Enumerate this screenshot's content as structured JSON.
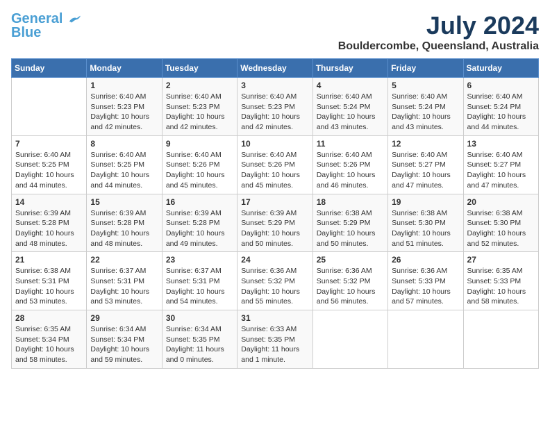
{
  "header": {
    "logo_line1": "General",
    "logo_line2": "Blue",
    "month_title": "July 2024",
    "location": "Bouldercombe, Queensland, Australia"
  },
  "days_of_week": [
    "Sunday",
    "Monday",
    "Tuesday",
    "Wednesday",
    "Thursday",
    "Friday",
    "Saturday"
  ],
  "weeks": [
    [
      {
        "num": "",
        "info": ""
      },
      {
        "num": "1",
        "info": "Sunrise: 6:40 AM\nSunset: 5:23 PM\nDaylight: 10 hours\nand 42 minutes."
      },
      {
        "num": "2",
        "info": "Sunrise: 6:40 AM\nSunset: 5:23 PM\nDaylight: 10 hours\nand 42 minutes."
      },
      {
        "num": "3",
        "info": "Sunrise: 6:40 AM\nSunset: 5:23 PM\nDaylight: 10 hours\nand 42 minutes."
      },
      {
        "num": "4",
        "info": "Sunrise: 6:40 AM\nSunset: 5:24 PM\nDaylight: 10 hours\nand 43 minutes."
      },
      {
        "num": "5",
        "info": "Sunrise: 6:40 AM\nSunset: 5:24 PM\nDaylight: 10 hours\nand 43 minutes."
      },
      {
        "num": "6",
        "info": "Sunrise: 6:40 AM\nSunset: 5:24 PM\nDaylight: 10 hours\nand 44 minutes."
      }
    ],
    [
      {
        "num": "7",
        "info": "Sunrise: 6:40 AM\nSunset: 5:25 PM\nDaylight: 10 hours\nand 44 minutes."
      },
      {
        "num": "8",
        "info": "Sunrise: 6:40 AM\nSunset: 5:25 PM\nDaylight: 10 hours\nand 44 minutes."
      },
      {
        "num": "9",
        "info": "Sunrise: 6:40 AM\nSunset: 5:26 PM\nDaylight: 10 hours\nand 45 minutes."
      },
      {
        "num": "10",
        "info": "Sunrise: 6:40 AM\nSunset: 5:26 PM\nDaylight: 10 hours\nand 45 minutes."
      },
      {
        "num": "11",
        "info": "Sunrise: 6:40 AM\nSunset: 5:26 PM\nDaylight: 10 hours\nand 46 minutes."
      },
      {
        "num": "12",
        "info": "Sunrise: 6:40 AM\nSunset: 5:27 PM\nDaylight: 10 hours\nand 47 minutes."
      },
      {
        "num": "13",
        "info": "Sunrise: 6:40 AM\nSunset: 5:27 PM\nDaylight: 10 hours\nand 47 minutes."
      }
    ],
    [
      {
        "num": "14",
        "info": "Sunrise: 6:39 AM\nSunset: 5:28 PM\nDaylight: 10 hours\nand 48 minutes."
      },
      {
        "num": "15",
        "info": "Sunrise: 6:39 AM\nSunset: 5:28 PM\nDaylight: 10 hours\nand 48 minutes."
      },
      {
        "num": "16",
        "info": "Sunrise: 6:39 AM\nSunset: 5:28 PM\nDaylight: 10 hours\nand 49 minutes."
      },
      {
        "num": "17",
        "info": "Sunrise: 6:39 AM\nSunset: 5:29 PM\nDaylight: 10 hours\nand 50 minutes."
      },
      {
        "num": "18",
        "info": "Sunrise: 6:38 AM\nSunset: 5:29 PM\nDaylight: 10 hours\nand 50 minutes."
      },
      {
        "num": "19",
        "info": "Sunrise: 6:38 AM\nSunset: 5:30 PM\nDaylight: 10 hours\nand 51 minutes."
      },
      {
        "num": "20",
        "info": "Sunrise: 6:38 AM\nSunset: 5:30 PM\nDaylight: 10 hours\nand 52 minutes."
      }
    ],
    [
      {
        "num": "21",
        "info": "Sunrise: 6:38 AM\nSunset: 5:31 PM\nDaylight: 10 hours\nand 53 minutes."
      },
      {
        "num": "22",
        "info": "Sunrise: 6:37 AM\nSunset: 5:31 PM\nDaylight: 10 hours\nand 53 minutes."
      },
      {
        "num": "23",
        "info": "Sunrise: 6:37 AM\nSunset: 5:31 PM\nDaylight: 10 hours\nand 54 minutes."
      },
      {
        "num": "24",
        "info": "Sunrise: 6:36 AM\nSunset: 5:32 PM\nDaylight: 10 hours\nand 55 minutes."
      },
      {
        "num": "25",
        "info": "Sunrise: 6:36 AM\nSunset: 5:32 PM\nDaylight: 10 hours\nand 56 minutes."
      },
      {
        "num": "26",
        "info": "Sunrise: 6:36 AM\nSunset: 5:33 PM\nDaylight: 10 hours\nand 57 minutes."
      },
      {
        "num": "27",
        "info": "Sunrise: 6:35 AM\nSunset: 5:33 PM\nDaylight: 10 hours\nand 58 minutes."
      }
    ],
    [
      {
        "num": "28",
        "info": "Sunrise: 6:35 AM\nSunset: 5:34 PM\nDaylight: 10 hours\nand 58 minutes."
      },
      {
        "num": "29",
        "info": "Sunrise: 6:34 AM\nSunset: 5:34 PM\nDaylight: 10 hours\nand 59 minutes."
      },
      {
        "num": "30",
        "info": "Sunrise: 6:34 AM\nSunset: 5:35 PM\nDaylight: 11 hours\nand 0 minutes."
      },
      {
        "num": "31",
        "info": "Sunrise: 6:33 AM\nSunset: 5:35 PM\nDaylight: 11 hours\nand 1 minute."
      },
      {
        "num": "",
        "info": ""
      },
      {
        "num": "",
        "info": ""
      },
      {
        "num": "",
        "info": ""
      }
    ]
  ]
}
